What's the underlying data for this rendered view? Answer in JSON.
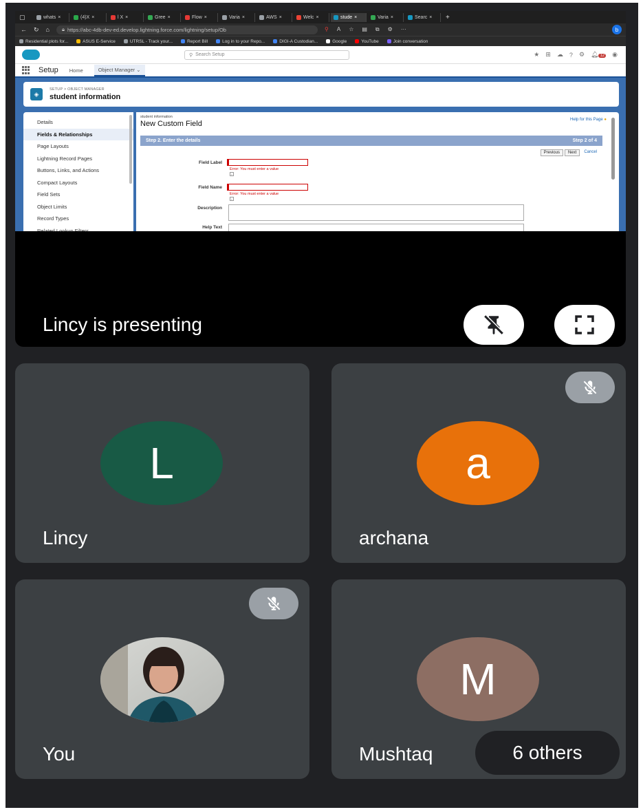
{
  "browser": {
    "tabs": [
      {
        "label": "whats",
        "color": "#9aa0a6"
      },
      {
        "label": "(4)X",
        "color": "#2aa84a"
      },
      {
        "label": "l X",
        "color": "#e53935"
      },
      {
        "label": "Gree",
        "color": "#34a853"
      },
      {
        "label": "Flow",
        "color": "#e53935"
      },
      {
        "label": "Varia",
        "color": "#9aa0a6"
      },
      {
        "label": "AWS",
        "color": "#9aa0a6"
      },
      {
        "label": "Welc",
        "color": "#ea4335"
      },
      {
        "label": "stude",
        "color": "#1798c1"
      },
      {
        "label": "Varia",
        "color": "#34a853"
      },
      {
        "label": "Searc",
        "color": "#1798c1"
      }
    ],
    "url": "https://abc-4db-dev-ed.develop.lightning.force.com/lightning/setup/Ob",
    "bookmarks": [
      {
        "label": "Residential plots for...",
        "color": "#9aa0a6"
      },
      {
        "label": "ASUS E-Service",
        "color": "#fbbc04"
      },
      {
        "label": "UTRSL - Track your...",
        "color": "#9aa0a6"
      },
      {
        "label": "Report Bill",
        "color": "#4285f4"
      },
      {
        "label": "Log in to your Repo...",
        "color": "#4285f4"
      },
      {
        "label": "DIGI-A Custodian...",
        "color": "#4285f4"
      },
      {
        "label": "Google",
        "color": "#ffffff"
      },
      {
        "label": "YouTube",
        "color": "#ff0000"
      },
      {
        "label": "Join conversation",
        "color": "#7b61ff"
      }
    ],
    "profile_initial": "b"
  },
  "salesforce": {
    "search_placeholder": "Search Setup",
    "notif_count": "12",
    "app_name": "Setup",
    "nav_tabs": [
      "Home",
      "Object Manager"
    ],
    "breadcrumb": "SETUP > OBJECT MANAGER",
    "object_name": "student information",
    "sidebar_items": [
      "Details",
      "Fields & Relationships",
      "Page Layouts",
      "Lightning Record Pages",
      "Buttons, Links, and Actions",
      "Compact Layouts",
      "Field Sets",
      "Object Limits",
      "Record Types",
      "Related Lookup Filters"
    ],
    "sidebar_active_index": 1,
    "page_subtitle": "student information",
    "page_title": "New Custom Field",
    "help_link": "Help for this Page",
    "step_label": "Step 2. Enter the details",
    "step_count": "Step 2 of 4",
    "buttons": {
      "previous": "Previous",
      "next": "Next",
      "cancel": "Cancel"
    },
    "fields": {
      "field_label": "Field Label",
      "field_name": "Field Name",
      "description": "Description",
      "help_text": "Help Text",
      "error": "Error: You must enter a value",
      "info": "i"
    }
  },
  "meeting": {
    "presenting_text": "Lincy is presenting",
    "participants": [
      {
        "name": "Lincy",
        "initial": "L",
        "color": "#185a45"
      },
      {
        "name": "archana",
        "initial": "a",
        "color": "#e8710a"
      },
      {
        "name": "You",
        "initial": "",
        "color": ""
      },
      {
        "name": "Mushtaq",
        "initial": "M",
        "color": "#8d6e63"
      }
    ],
    "others_label": "6 others"
  }
}
